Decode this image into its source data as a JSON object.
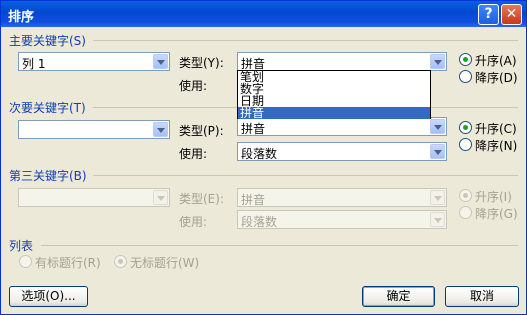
{
  "title": "排序",
  "titlebar": {
    "help": "?",
    "close": "✕"
  },
  "key1": {
    "section": "主要关键字(S)",
    "column_value": "列 1",
    "type_label": "类型(Y):",
    "type_value": "拼音",
    "use_label": "使用:",
    "asc_label": "升序(A)",
    "desc_label": "降序(D)",
    "dropdown_options": [
      "笔划",
      "数字",
      "日期",
      "拼音"
    ],
    "dropdown_selected": "拼音"
  },
  "key2": {
    "section": "次要关键字(T)",
    "column_value": "",
    "type_label": "类型(P):",
    "type_value": "拼音",
    "use_label": "使用:",
    "use_value": "段落数",
    "asc_label": "升序(C)",
    "desc_label": "降序(N)"
  },
  "key3": {
    "section": "第三关键字(B)",
    "column_value": "",
    "type_label": "类型(E):",
    "type_value": "拼音",
    "use_label": "使用:",
    "use_value": "段落数",
    "asc_label": "升序(I)",
    "desc_label": "降序(G)"
  },
  "list": {
    "section": "列表",
    "with_header": "有标题行(R)",
    "no_header": "无标题行(W)"
  },
  "buttons": {
    "options": "选项(O)...",
    "ok": "确定",
    "cancel": "取消"
  }
}
